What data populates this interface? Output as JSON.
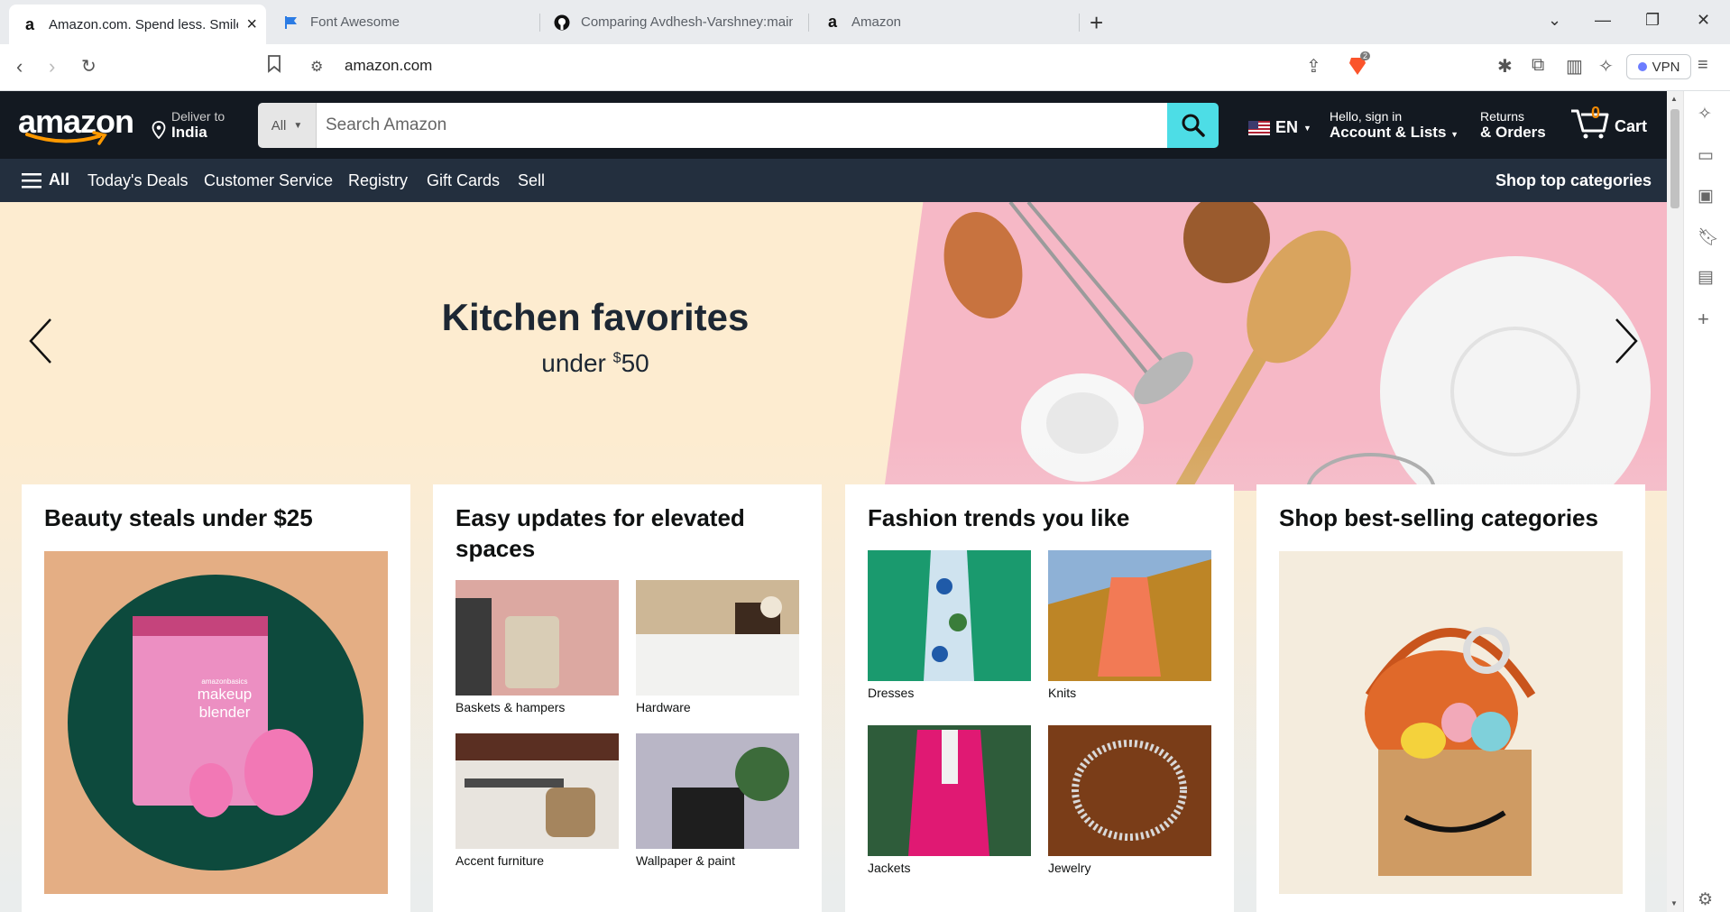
{
  "browser": {
    "tabs": [
      {
        "title": "Amazon.com. Spend less. Smile",
        "favicon": "amazon-favicon",
        "active": true
      },
      {
        "title": "Font Awesome",
        "favicon": "font-awesome-favicon",
        "active": false
      },
      {
        "title": "Comparing Avdhesh-Varshney:main",
        "favicon": "github-favicon",
        "active": false
      },
      {
        "title": "Amazon",
        "favicon": "amazon-favicon",
        "active": false
      }
    ],
    "url": "amazon.com",
    "shields_badge": "2",
    "vpn_label": "VPN"
  },
  "header": {
    "logo": "amazon",
    "deliver_small": "Deliver to",
    "deliver_big": "India",
    "search_category": "All",
    "search_placeholder": "Search Amazon",
    "language": "EN",
    "account_line1": "Hello, sign in",
    "account_line2": "Account & Lists",
    "returns_line1": "Returns",
    "returns_line2": "& Orders",
    "cart_count": "0",
    "cart_label": "Cart"
  },
  "nav": {
    "all_label": "All",
    "items": [
      "Today's Deals",
      "Customer Service",
      "Registry",
      "Gift Cards",
      "Sell"
    ],
    "right": "Shop top categories"
  },
  "hero": {
    "title": "Kitchen favorites",
    "subtitle_pre": "under ",
    "subtitle_sup": "$",
    "subtitle_num": "50"
  },
  "cards": [
    {
      "title": "Beauty steals under $25",
      "image_text": [
        "amazonbasics",
        "makeup",
        "blender"
      ]
    },
    {
      "title": "Easy updates for elevated spaces",
      "items": [
        "Baskets & hampers",
        "Hardware",
        "Accent furniture",
        "Wallpaper & paint"
      ]
    },
    {
      "title": "Fashion trends you like",
      "items": [
        "Dresses",
        "Knits",
        "Jackets",
        "Jewelry"
      ]
    },
    {
      "title": "Shop best-selling categories"
    }
  ],
  "colors": {
    "amazon_dark": "#131921",
    "amazon_nav": "#232f3e",
    "search_button": "#4ddde6",
    "amazon_orange": "#f08804",
    "hero_bg": "#fdecd0"
  }
}
